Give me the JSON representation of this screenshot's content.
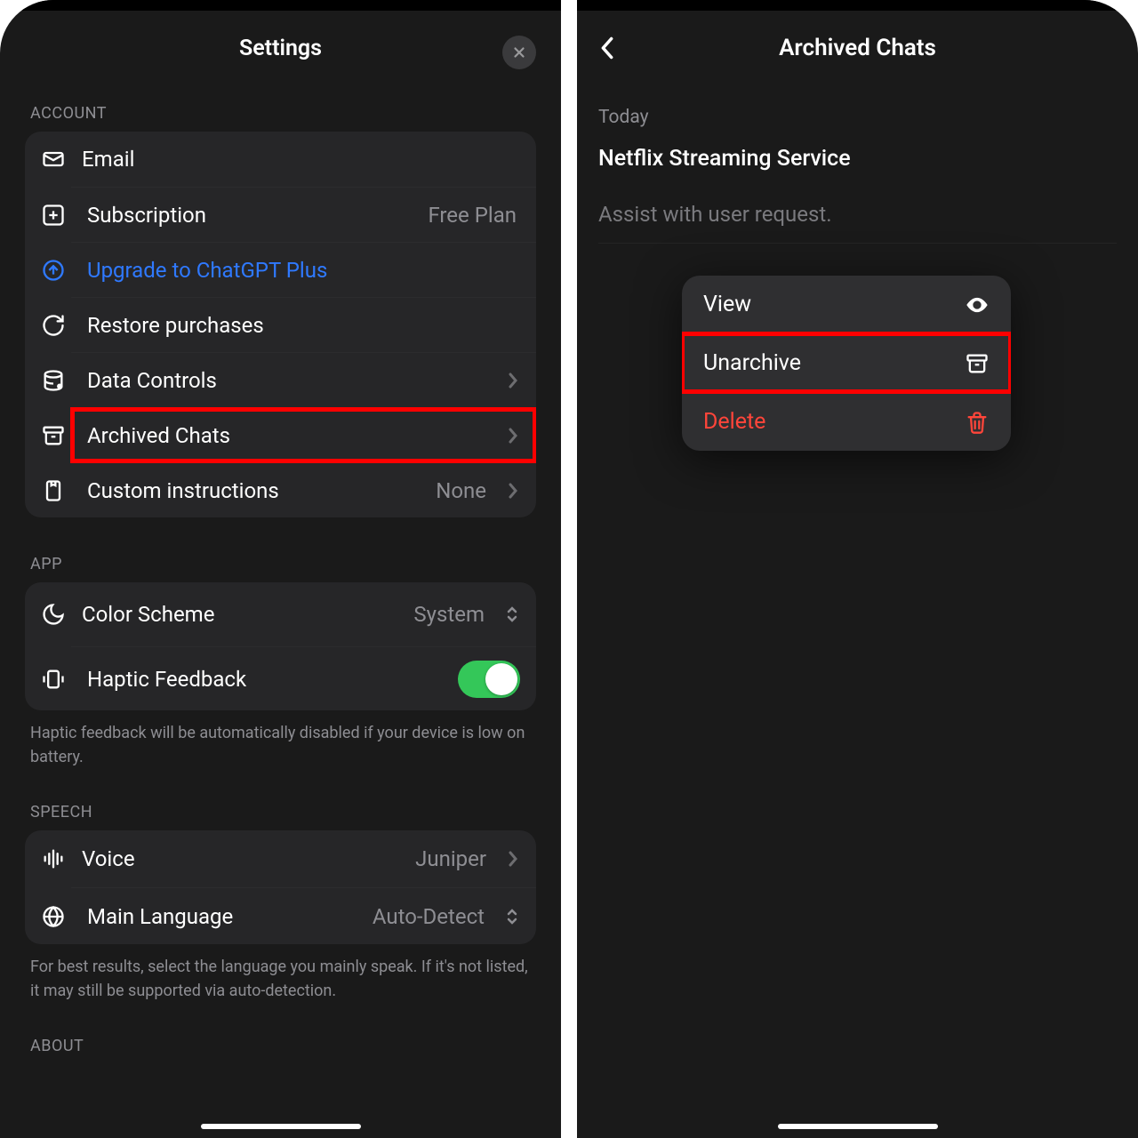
{
  "left": {
    "title": "Settings",
    "sections": {
      "account": {
        "label": "ACCOUNT",
        "rows": {
          "email": "Email",
          "subscription": "Subscription",
          "subscription_value": "Free Plan",
          "upgrade": "Upgrade to ChatGPT Plus",
          "restore": "Restore purchases",
          "data_controls": "Data Controls",
          "archived": "Archived Chats",
          "custom_instructions": "Custom instructions",
          "custom_instructions_value": "None"
        }
      },
      "app": {
        "label": "APP",
        "rows": {
          "color_scheme": "Color Scheme",
          "color_scheme_value": "System",
          "haptic": "Haptic Feedback"
        },
        "note": "Haptic feedback will be automatically disabled if your device is low on battery."
      },
      "speech": {
        "label": "SPEECH",
        "rows": {
          "voice": "Voice",
          "voice_value": "Juniper",
          "main_lang": "Main Language",
          "main_lang_value": "Auto-Detect"
        },
        "note": "For best results, select the language you mainly speak. If it's not listed, it may still be supported via auto-detection."
      },
      "about": {
        "label": "ABOUT"
      }
    }
  },
  "right": {
    "title": "Archived Chats",
    "date_label": "Today",
    "chat_title": "Netflix Streaming Service",
    "chat_sub": "Assist with user request.",
    "menu": {
      "view": "View",
      "unarchive": "Unarchive",
      "delete": "Delete"
    }
  }
}
